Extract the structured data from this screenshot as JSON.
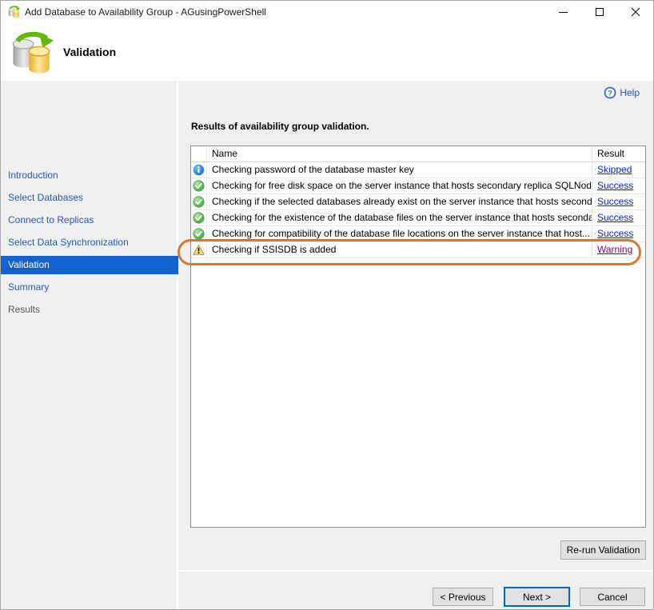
{
  "window": {
    "title": "Add Database to Availability Group - AGusingPowerShell",
    "controls": [
      {
        "name": "minimize-button"
      },
      {
        "name": "maximize-button"
      },
      {
        "name": "close-button"
      }
    ]
  },
  "header": {
    "step_title": "Validation",
    "icon": "database-sync-icon"
  },
  "sidebar": {
    "items": [
      {
        "label": "Introduction",
        "state": "enabled"
      },
      {
        "label": "Select Databases",
        "state": "enabled"
      },
      {
        "label": "Connect to Replicas",
        "state": "enabled"
      },
      {
        "label": "Select Data Synchronization",
        "state": "enabled"
      },
      {
        "label": "Validation",
        "state": "selected"
      },
      {
        "label": "Summary",
        "state": "enabled"
      },
      {
        "label": "Results",
        "state": "disabled"
      }
    ]
  },
  "help": {
    "label": "Help",
    "icon": "help-question-icon"
  },
  "main": {
    "caption": "Results of availability group validation.",
    "table": {
      "columns": [
        "Name",
        "Result"
      ],
      "rows": [
        {
          "icon": "info-icon",
          "name": "Checking password of the database master key",
          "result": "Skipped",
          "result_kind": "link-blue"
        },
        {
          "icon": "success-icon",
          "name": "Checking for free disk space on the server instance that hosts secondary replica SQLNod...",
          "result": "Success",
          "result_kind": "link-blue"
        },
        {
          "icon": "success-icon",
          "name": "Checking if the selected databases already exist on the server instance that hosts second...",
          "result": "Success",
          "result_kind": "link-blue"
        },
        {
          "icon": "success-icon",
          "name": "Checking for the existence of the database files on the server instance that hosts seconda...",
          "result": "Success",
          "result_kind": "link-blue"
        },
        {
          "icon": "success-icon",
          "name": "Checking for compatibility of the database file locations on the server instance that host...",
          "result": "Success",
          "result_kind": "link-blue"
        },
        {
          "icon": "warning-icon",
          "name": "Checking if SSISDB is added",
          "result": "Warning",
          "result_kind": "link-visited"
        }
      ]
    },
    "rerun_button": "Re-run Validation",
    "annotation": {
      "type": "highlight-ellipse",
      "target_row": "Checking if SSISDB is added",
      "color": "#d9782a"
    }
  },
  "footer": {
    "previous": "< Previous",
    "next": "Next >",
    "cancel": "Cancel"
  },
  "colors": {
    "accent_selected": "#1363ce",
    "sidebar_link": "#2458c5",
    "link_blue": "#0b24cb",
    "link_visited": "#800080",
    "panel_gray": "#f0f0f0",
    "annotation_orange": "#d9782a"
  }
}
